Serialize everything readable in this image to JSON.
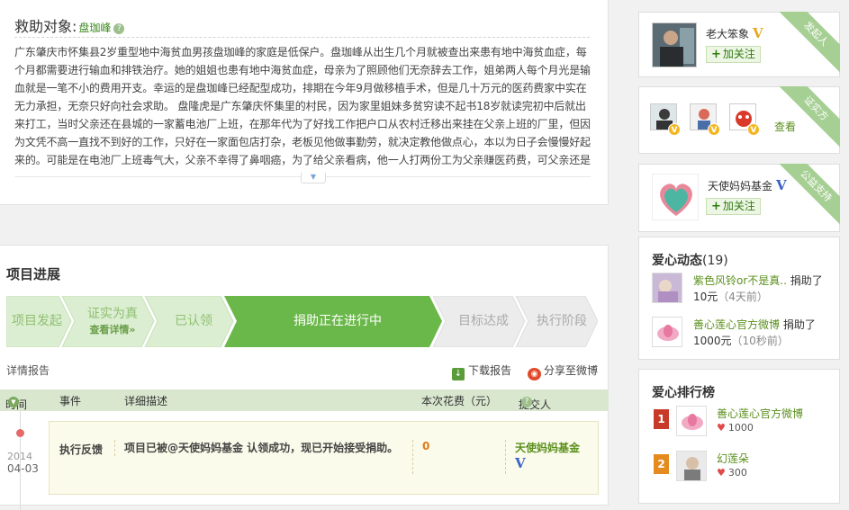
{
  "help": {
    "title": "救助对象:",
    "name": "盘珈峰",
    "text": "广东肇庆市怀集县2岁重型地中海贫血男孩盘珈峰的家庭是低保户。盘珈峰从出生几个月就被查出来患有地中海贫血症，每个月都需要进行输血和排铁治疗。她的姐姐也患有地中海贫血症，母亲为了照顾他们无奈辞去工作，姐弟两人每个月光是输血就是一笔不小的费用开支。幸运的是盘珈峰已经配型成功，排期在今年9月做移植手术，但是几十万元的医药费家中实在无力承担，无奈只好向社会求助。 盘隆虎是广东肇庆怀集里的村民，因为家里姐妹多贫穷读不起书18岁就读完初中后就出来打工，当时父亲还在县城的一家蓄电池厂上班，在那年代为了好找工作把户口从农村迁移出来挂在父亲上班的厂里，但因为文凭不高一直找不到好的工作，只好在一家面包店打杂，老板见他做事勤劳，就决定教他做点心，本以为日子会慢慢好起来的。可能是在电池厂上班毒气大，父亲不幸得了鼻咽癌，为了给父亲看病，他一人打两份工为父亲赚医药费，可父亲还是撒手人寰去了另一个世界，给家里留"
  },
  "progress": {
    "title": "项目进展",
    "steps": [
      {
        "label": "项目发起",
        "sub": ""
      },
      {
        "label": "证实为真",
        "sub": "查看详情»"
      },
      {
        "label": "已认领",
        "sub": ""
      },
      {
        "label": "捐助正在进行中",
        "sub": ""
      },
      {
        "label": "目标达成",
        "sub": ""
      },
      {
        "label": "执行阶段",
        "sub": ""
      }
    ],
    "detail_link": "详情报告",
    "download": "下载报告",
    "share": "分享至微博",
    "columns": [
      "时间",
      "事件",
      "详细描述",
      "本次花费（元）",
      "提交人"
    ],
    "row": {
      "year": "2014",
      "date": "04-03",
      "event": "执行反馈",
      "desc": "项目已被@天使妈妈基金 认领成功，现已开始接受捐助。",
      "cost": "0",
      "submitter": "天使妈妈基金",
      "badge": "V"
    }
  },
  "sidebar": {
    "initiator": {
      "ribbon": "发起人",
      "name": "老大笨象",
      "badge": "V",
      "follow": "加关注"
    },
    "witness": {
      "ribbon": "证实方",
      "view": "查看",
      "badge": "V"
    },
    "charity": {
      "ribbon": "公益支持",
      "name": "天使妈妈基金",
      "badge": "V",
      "follow": "加关注",
      "logo_text": "天使妈妈"
    },
    "activity": {
      "title": "爱心动态",
      "count": "(19)",
      "items": [
        {
          "name": "紫色风铃or不是真..",
          "action": "捐助了",
          "amount": "10元",
          "time": "（4天前）"
        },
        {
          "name": "善心莲心官方微博",
          "action": "捐助了",
          "amount": "1000元",
          "time": "（10秒前）"
        }
      ]
    },
    "ranking": {
      "title": "爱心排行榜",
      "items": [
        {
          "rank": "1",
          "name": "善心莲心官方微博",
          "score": "1000"
        },
        {
          "rank": "2",
          "name": "幻莲朵",
          "score": "300"
        }
      ]
    }
  },
  "colors": {
    "brand_green": "#5a9b3a",
    "active_step": "#6bb84a",
    "header_green": "#d9e7cf",
    "cost_orange": "#e07b1a",
    "verified_blue": "#3a63c8",
    "verified_gold": "#e6a91b"
  }
}
